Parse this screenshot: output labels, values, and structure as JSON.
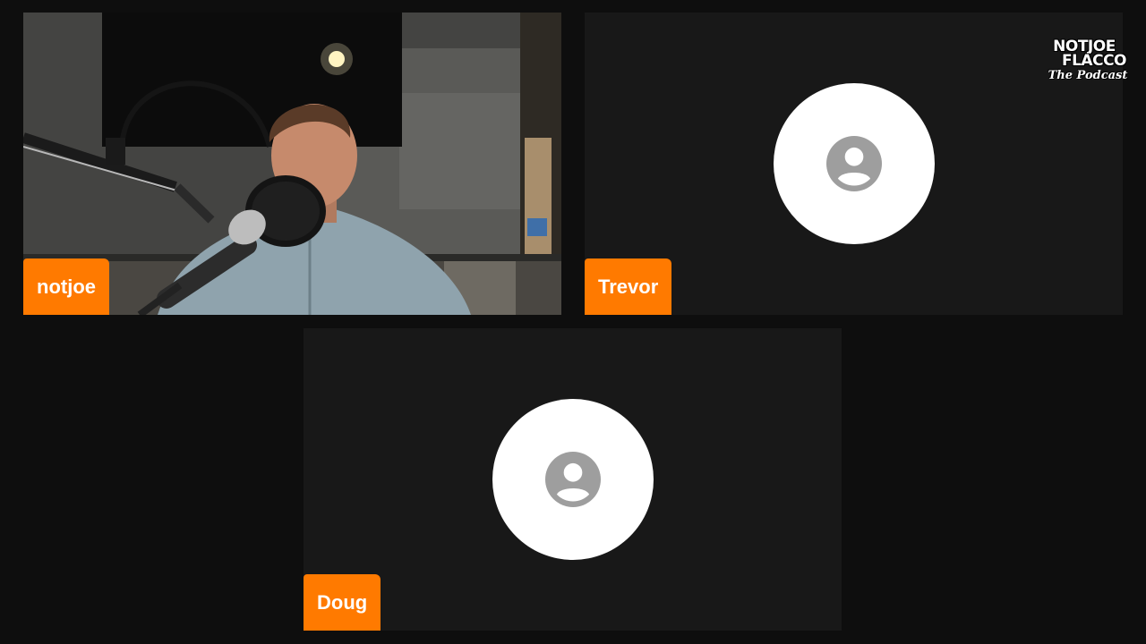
{
  "participants": [
    {
      "name": "notjoe",
      "video_on": true
    },
    {
      "name": "Trevor",
      "video_on": false
    },
    {
      "name": "Doug",
      "video_on": false
    }
  ],
  "logo": {
    "line1": "NOTJOE",
    "line2": "FLACCO",
    "line3": "The Podcast"
  },
  "colors": {
    "background": "#0e0e0e",
    "tile": "#181818",
    "name_tag": "#ff7a00",
    "avatar_circle": "#ffffff",
    "avatar_icon": "#9e9e9e"
  },
  "icons": {
    "avatar": "user-placeholder-icon"
  }
}
